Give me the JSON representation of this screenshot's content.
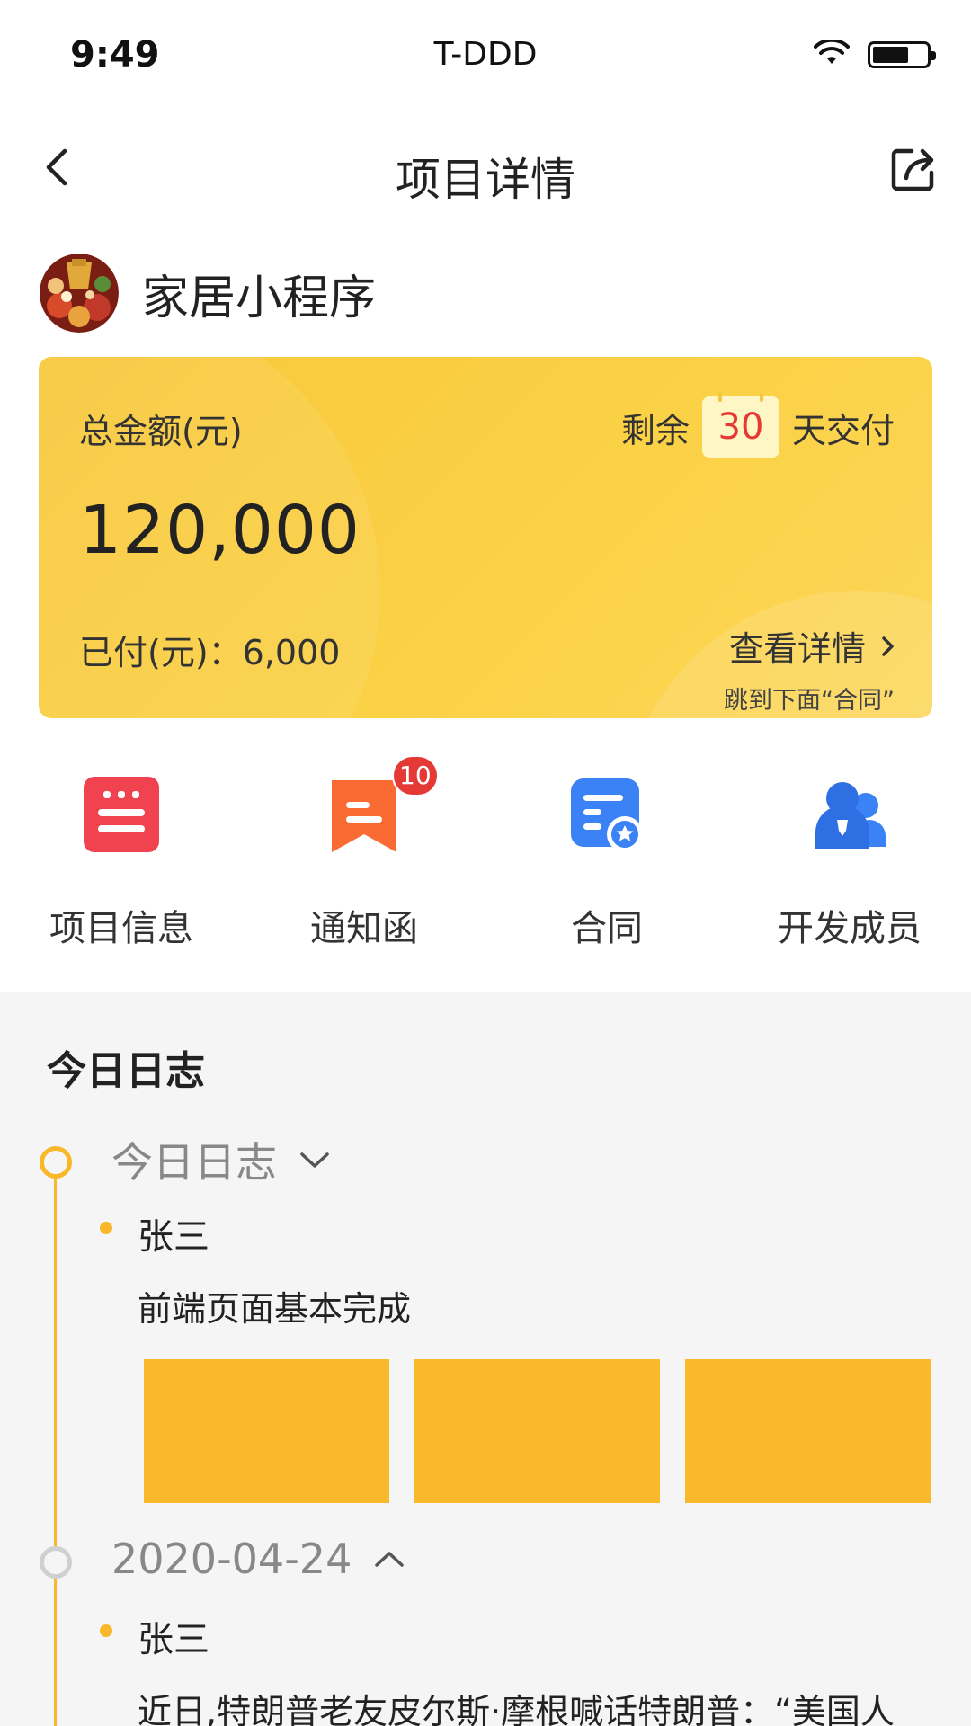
{
  "status_bar": {
    "time": "9:49",
    "carrier": "T-DDD",
    "icons": [
      "wifi-icon",
      "battery-icon"
    ]
  },
  "nav": {
    "title": "项目详情",
    "back_icon": "chevron-left-icon",
    "share_icon": "share-icon"
  },
  "project": {
    "name": "家居小程序"
  },
  "summary": {
    "total_label": "总金额(元)",
    "remaining_prefix": "剩余",
    "remaining_days": "30",
    "remaining_suffix": "天交付",
    "total_amount": "120,000",
    "paid_text": "已付(元)：6,000",
    "detail_link": "查看详情",
    "jump_note": "跳到下面“合同”"
  },
  "quick_actions": [
    {
      "label": "项目信息",
      "icon": "list-icon",
      "color": "#f0424f"
    },
    {
      "label": "通知函",
      "icon": "bookmark-icon",
      "color": "#fa6b34",
      "badge": "10"
    },
    {
      "label": "合同",
      "icon": "contract-icon",
      "color": "#3b82f6"
    },
    {
      "label": "开发成员",
      "icon": "team-icon",
      "color": "#3b82f6"
    }
  ],
  "log": {
    "title": "今日日志",
    "entries": [
      {
        "header": "今日日志",
        "toggle_icon": "chevron-down-icon",
        "author": "张三",
        "text": "前端页面基本完成",
        "images": 3
      },
      {
        "header": "2020-04-24",
        "toggle_icon": "chevron-up-icon",
        "author": "张三",
        "text": "近日,特朗普老友皮尔斯·摩根喊话特朗普：“美国人"
      }
    ]
  },
  "colors": {
    "accent": "#f9b72a",
    "card": "#fbd247",
    "badge": "#e53935"
  }
}
